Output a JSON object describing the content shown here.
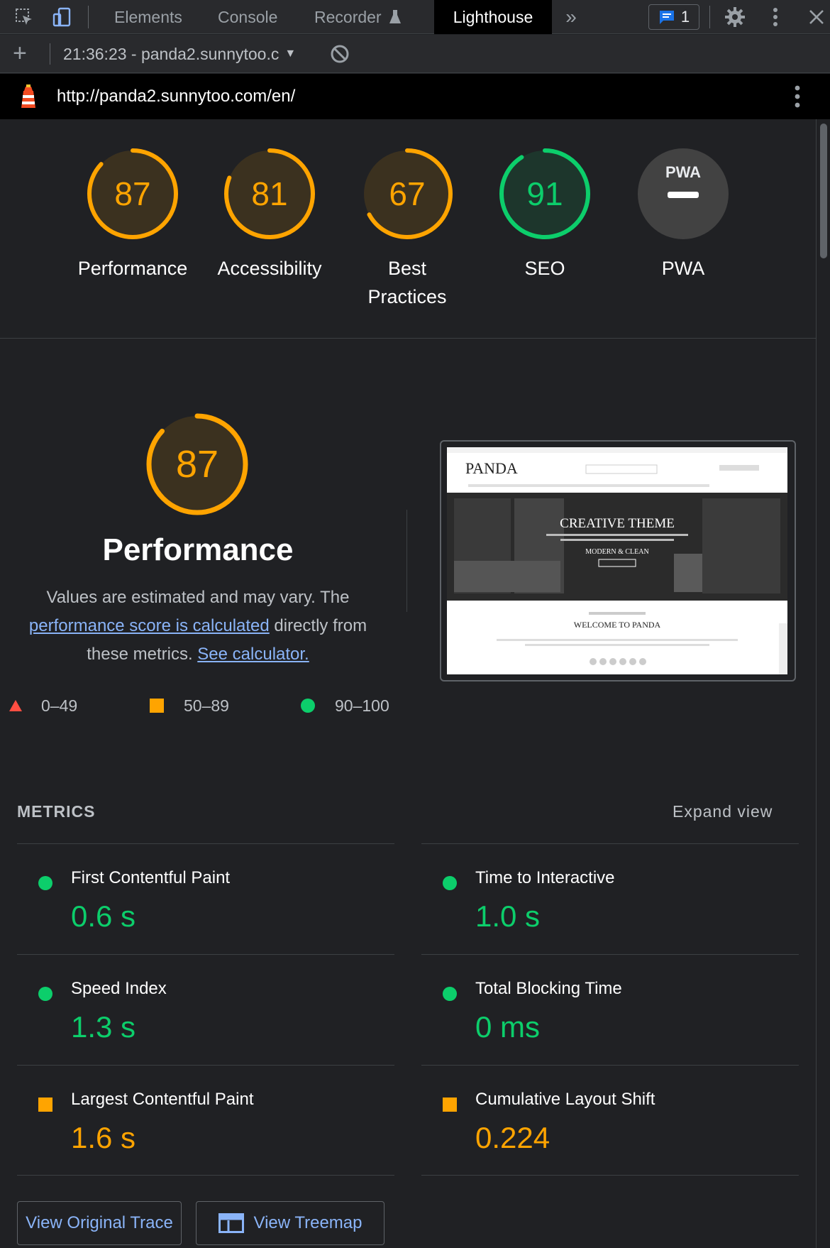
{
  "devtools": {
    "tabs": [
      "Elements",
      "Console",
      "Recorder",
      "Lighthouse"
    ],
    "active_tab": "Lighthouse",
    "issues_count": "1"
  },
  "report": {
    "selector_label": "21:36:23 - panda2.sunnytoo.c",
    "url": "http://panda2.sunnytoo.com/en/"
  },
  "scores": [
    {
      "label": "Performance",
      "value": "87",
      "fraction": 0.87,
      "status": "average"
    },
    {
      "label": "Accessibility",
      "value": "81",
      "fraction": 0.81,
      "status": "average"
    },
    {
      "label": "Best Practices",
      "value": "67",
      "fraction": 0.67,
      "status": "average"
    },
    {
      "label": "SEO",
      "value": "91",
      "fraction": 0.91,
      "status": "pass"
    },
    {
      "label": "PWA",
      "value": "",
      "badge": "PWA",
      "status": "na"
    }
  ],
  "performance": {
    "score": "87",
    "fraction": 0.87,
    "title": "Performance",
    "desc_prefix": "Values are estimated and may vary. The ",
    "desc_link": "performance score is calculated",
    "desc_middle": " directly from these metrics. ",
    "calc_link": "See calculator.",
    "legend": [
      "0–49",
      "50–89",
      "90–100"
    ]
  },
  "thumbnail": {
    "brand": "PANDA",
    "hero_title": "CREATIVE THEME",
    "hero_sub": "MODERN & CLEAN",
    "welcome": "WELCOME TO PANDA"
  },
  "metrics": {
    "heading": "METRICS",
    "expand": "Expand view",
    "items": [
      {
        "name": "First Contentful Paint",
        "value": "0.6 s",
        "status": "pass"
      },
      {
        "name": "Time to Interactive",
        "value": "1.0 s",
        "status": "pass"
      },
      {
        "name": "Speed Index",
        "value": "1.3 s",
        "status": "pass"
      },
      {
        "name": "Total Blocking Time",
        "value": "0 ms",
        "status": "pass"
      },
      {
        "name": "Largest Contentful Paint",
        "value": "1.6 s",
        "status": "average"
      },
      {
        "name": "Cumulative Layout Shift",
        "value": "0.224",
        "status": "average"
      }
    ]
  },
  "actions": {
    "trace": "View Original Trace",
    "treemap": "View Treemap"
  },
  "colors": {
    "pass": "#0cce6b",
    "average": "#ffa400",
    "fail": "#ff4e42",
    "link": "#8ab4f8"
  }
}
